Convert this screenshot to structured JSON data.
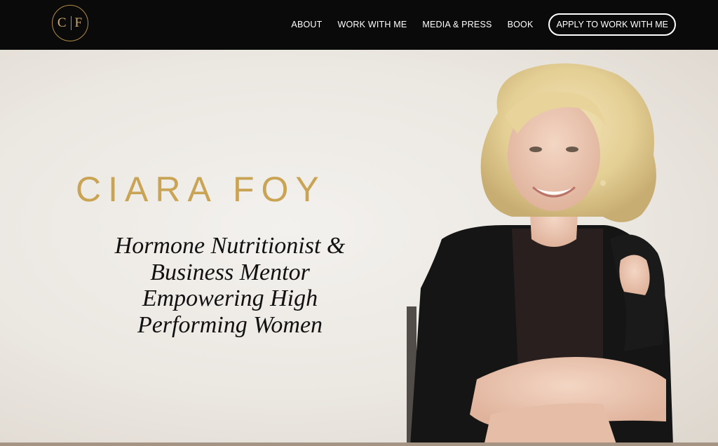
{
  "logo": {
    "left": "C",
    "right": "F"
  },
  "nav": {
    "items": [
      "ABOUT",
      "WORK WITH ME",
      "MEDIA & PRESS",
      "BOOK"
    ],
    "cta": "APPLY TO WORK WITH ME"
  },
  "hero": {
    "name": "CIARA FOY",
    "tagline_lines": [
      "Hormone Nutritionist &",
      "Business Mentor",
      "Empowering High",
      "Performing Women"
    ]
  },
  "colors": {
    "topbar": "#0b0a0a",
    "gold": "#c9a455",
    "hero_bg": "#ece8e2",
    "text": "#111111"
  }
}
